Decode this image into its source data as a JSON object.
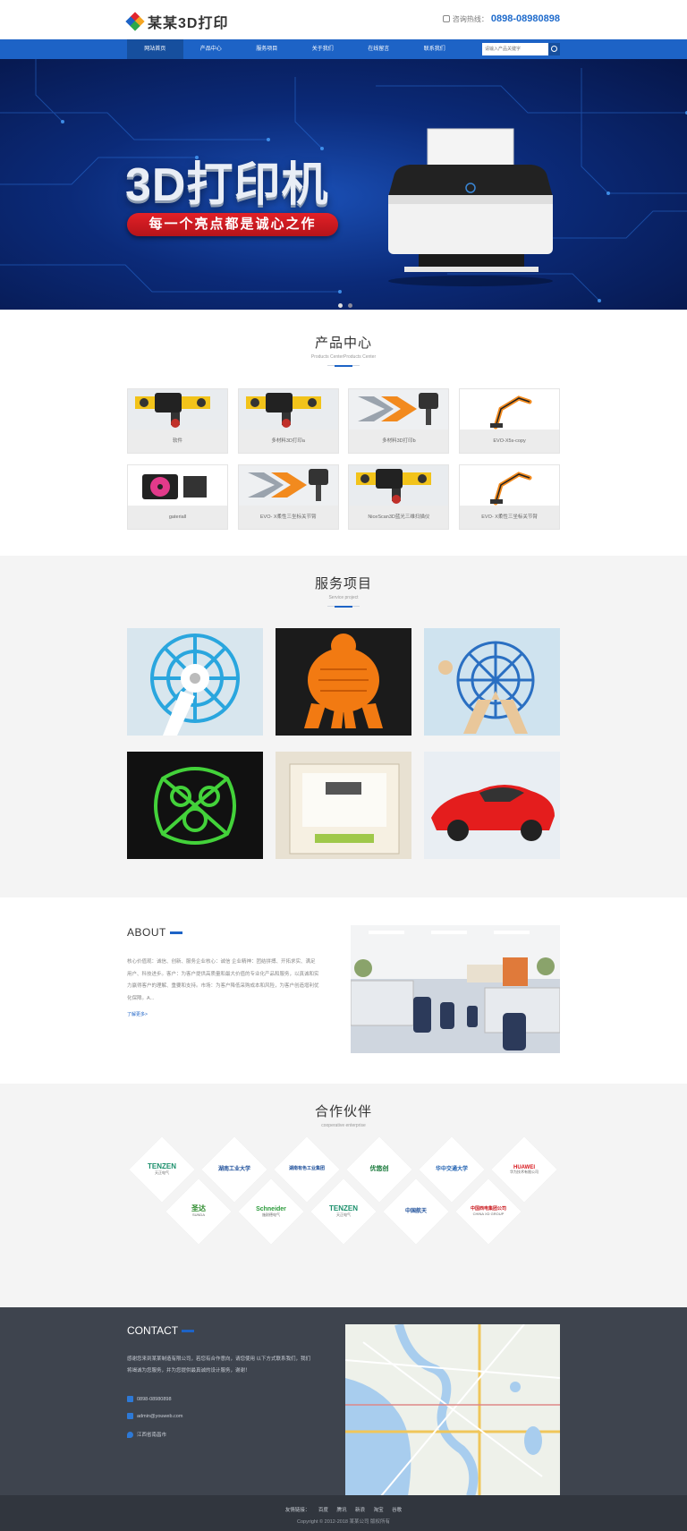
{
  "header": {
    "logo_text": "某某3D打印",
    "hotline_label": "咨询热线：",
    "hotline_number": "0898-08980898"
  },
  "nav": {
    "items": [
      "网站首页",
      "产品中心",
      "服务项目",
      "关于我们",
      "在线留言",
      "联系我们"
    ],
    "search_placeholder": "请输入产品关键字"
  },
  "banner": {
    "headline": "3D打印机",
    "slogan": "每一个亮点都是诚心之作"
  },
  "products": {
    "title": "产品中心",
    "subtitle": "Products CenterProducts Center",
    "items": [
      "软件",
      "多材料3D打印a",
      "多材料3D打印b",
      "EVO-X5s-copy",
      "gateriall",
      "EVO- X柔性三坐标关节臂",
      "NiceScan3D蓝光三维扫描仪",
      "EVO- X柔性三坐标关节臂"
    ]
  },
  "services": {
    "title": "服务项目",
    "subtitle": "Service project"
  },
  "about": {
    "title": "ABOUT",
    "text": "核心价值观：诚信、创新、服务企业核心：诚信 企业精神：团结拼搏、开拓求实、满足用户、科技进步。客户：为客户提供高质量和最大价值的专业化产品和服务，以真诚和实力赢得客户的理解、重要和支持。市场：为客户降低采购成本和风险，为客户创造增利优化保障。A...",
    "more": "了解更多>"
  },
  "partners": {
    "title": "合作伙伴",
    "subtitle": "cooperative enterprise",
    "logos": [
      {
        "name": "TENZEN",
        "sub": "天正电气"
      },
      {
        "name": "湖南工业大学",
        "sub": ""
      },
      {
        "name": "湖南有色工业集团",
        "sub": ""
      },
      {
        "name": "优悠创",
        "sub": ""
      },
      {
        "name": "华中交通大学",
        "sub": ""
      },
      {
        "name": "HUAWEI",
        "sub": "华为技术有限公司"
      },
      {
        "name": "圣达",
        "sub": "SUNDA"
      },
      {
        "name": "Schneider",
        "sub": "施耐德电气"
      },
      {
        "name": "TENZEN",
        "sub": "天正电气"
      },
      {
        "name": "中国航天",
        "sub": ""
      },
      {
        "name": "中国西电集团公司",
        "sub": "CHINA XD GROUP"
      }
    ]
  },
  "contact": {
    "title": "CONTACT",
    "intro": "感谢您来到某某制造有限公司，若您有合作意向，请您使用 以下方式联系我们，我们将竭诚为您服务，并为您提供最真诚的设计服务，谢谢！",
    "phone": "0898-08980898",
    "email": "admin@youweb.com",
    "address": "江西省南昌市"
  },
  "footer": {
    "links_label": "友情链接：",
    "links": [
      "百度",
      "腾讯",
      "新浪",
      "淘宝",
      "谷歌"
    ],
    "copyright": "Copyright © 2012-2018 某某公司 版权所有"
  },
  "colors": {
    "brand_blue": "#1d63c6",
    "nav_active": "#164f9e",
    "slogan_red": "#e22027",
    "contact_bg": "#3e444e"
  }
}
